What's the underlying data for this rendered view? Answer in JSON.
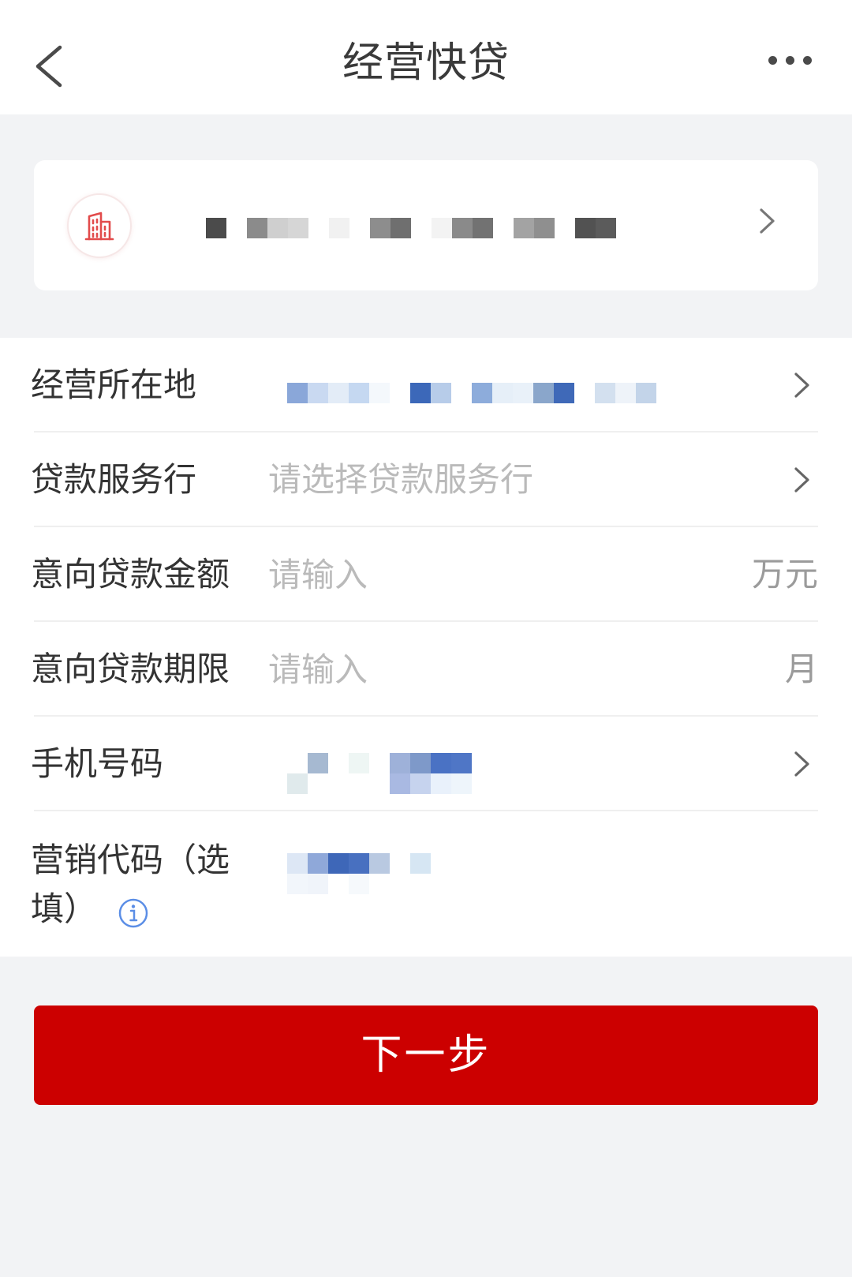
{
  "header": {
    "title": "经营快贷",
    "back_icon": "chevron-left-icon",
    "more_icon": "more-horizontal-icon"
  },
  "company_card": {
    "icon": "building-icon",
    "arrow_icon": "chevron-right-icon"
  },
  "form": {
    "location": {
      "label": "经营所在地",
      "arrow_icon": "chevron-right-icon"
    },
    "bank": {
      "label": "贷款服务行",
      "placeholder": "请选择贷款服务行",
      "arrow_icon": "chevron-right-icon"
    },
    "amount": {
      "label": "意向贷款金额",
      "placeholder": "请输入",
      "unit": "万元"
    },
    "term": {
      "label": "意向贷款期限",
      "placeholder": "请输入",
      "unit": "月"
    },
    "phone": {
      "label": "手机号码",
      "arrow_icon": "chevron-right-icon"
    },
    "marketing_code": {
      "label": "营销代码（选填）",
      "info_icon": "info-icon"
    }
  },
  "actions": {
    "next_label": "下一步"
  },
  "colors": {
    "primary": "#cc0000",
    "info": "#5b8ee6",
    "icon_accent": "#e24b4b",
    "page_background": "#f2f3f5"
  }
}
